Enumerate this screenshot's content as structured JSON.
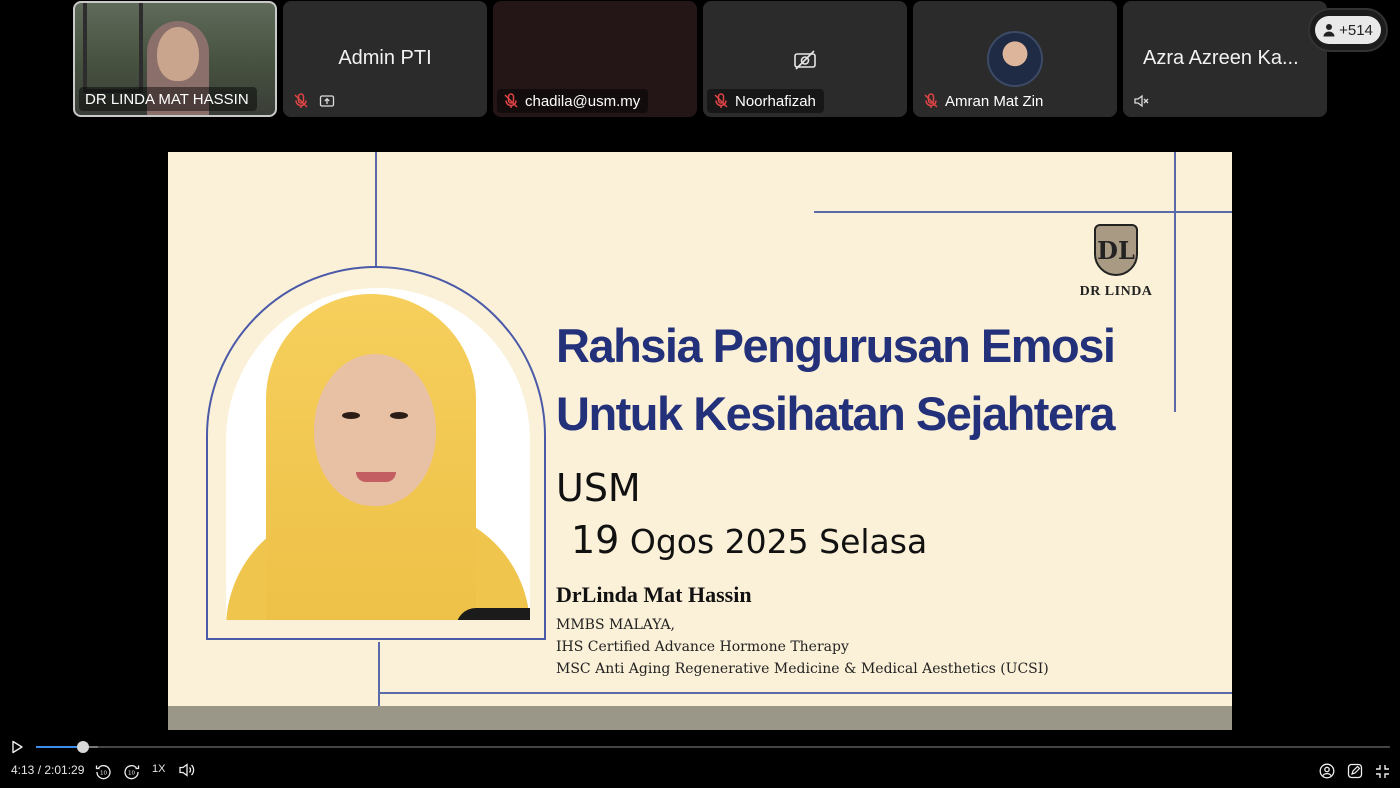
{
  "participants": [
    {
      "name": "DR LINDA MAT HASSIN",
      "has_video": true
    },
    {
      "name": "Admin PTI",
      "label_icons": [
        "mic-off",
        "screen-share"
      ]
    },
    {
      "name": "chadila@usm.my"
    },
    {
      "name": "Noorhafizah",
      "camera_off": true
    },
    {
      "name": "Amran Mat Zin",
      "has_avatar": true
    },
    {
      "name": "Azra Azreen Ka..."
    }
  ],
  "participant_count": "+514",
  "slide": {
    "logo_text": "DR LINDA",
    "logo_mark": "DL",
    "title_line1": "Rahsia Pengurusan Emosi",
    "title_line2": "Untuk Kesihatan Sejahtera",
    "venue": "USM",
    "date_day": "19",
    "date_rest": " Ogos 2025 Selasa",
    "speaker": "DrLinda Mat Hassin",
    "credentials": [
      "MMBS MALAYA,",
      "IHS Certified Advance Hormone Therapy",
      "MSC Anti Aging Regenerative Medicine & Medical Aesthetics (UCSI)"
    ]
  },
  "player": {
    "current_time": "4:13",
    "duration": "2:01:29",
    "time_display": "4:13 / 2:01:29",
    "speed": "1X",
    "progress_fraction": 0.0347,
    "accent_color": "#3d8ee8"
  }
}
